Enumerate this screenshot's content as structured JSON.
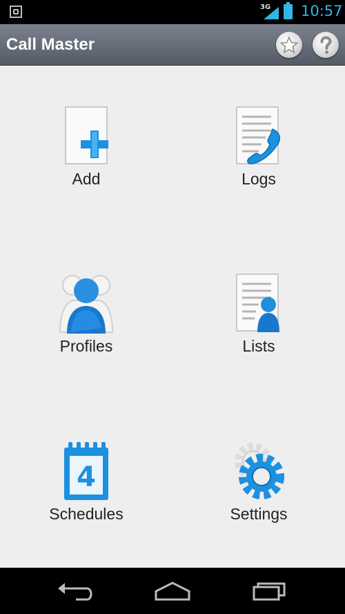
{
  "status_bar": {
    "network": "3G",
    "time": "10:57"
  },
  "action_bar": {
    "title": "Call Master",
    "icons": [
      "star-icon",
      "help-icon"
    ]
  },
  "menu": [
    {
      "label": "Add",
      "icon": "add-document-icon"
    },
    {
      "label": "Logs",
      "icon": "call-log-icon"
    },
    {
      "label": "Profiles",
      "icon": "profiles-icon"
    },
    {
      "label": "Lists",
      "icon": "contact-list-icon"
    },
    {
      "label": "Schedules",
      "icon": "calendar-icon"
    },
    {
      "label": "Settings",
      "icon": "gear-icon"
    }
  ],
  "calendar_day": "4",
  "nav_bar": {
    "buttons": [
      "back-icon",
      "home-icon",
      "recent-apps-icon"
    ]
  },
  "colors": {
    "accent": "#33b5e5",
    "icon_blue": "#1e90e0",
    "action_bar_top": "#7b818d",
    "action_bar_bottom": "#555b66",
    "background": "#eeeeee"
  }
}
